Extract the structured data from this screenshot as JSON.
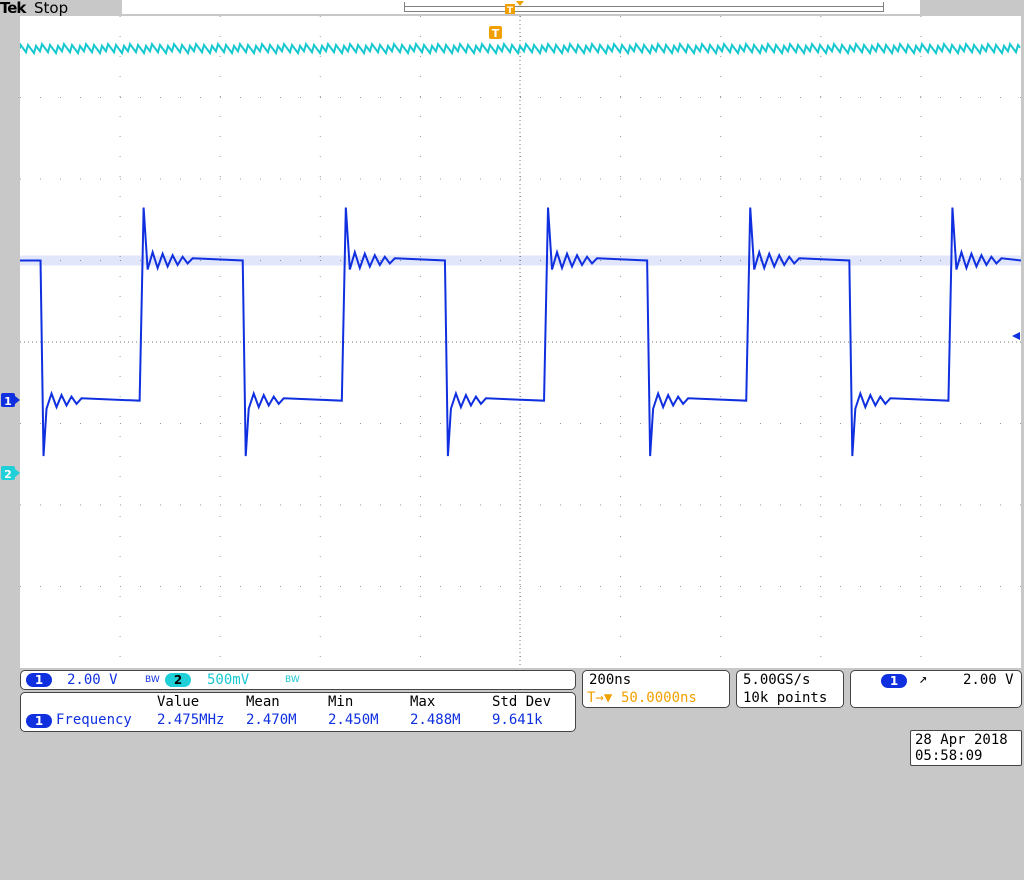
{
  "header": {
    "brand": "Tek",
    "status": "Stop"
  },
  "markers": {
    "trigger": "T",
    "ch1": "1",
    "ch2": "2"
  },
  "channels": {
    "ch1": {
      "num": "1",
      "scale": "2.00 V",
      "bw": "BW",
      "color": "#1030e0"
    },
    "ch2": {
      "num": "2",
      "scale": "500mV",
      "bw": "BW",
      "color": "#18c8d0"
    }
  },
  "timebase": {
    "scale": "200ns",
    "delay": "50.0000ns",
    "delay_prefix": "T→▼"
  },
  "acquisition": {
    "rate": "5.00GS/s",
    "points": "10k points"
  },
  "trigger": {
    "source": "1",
    "slope": "↗",
    "level": "2.00 V"
  },
  "measurement": {
    "headers": [
      "Value",
      "Mean",
      "Min",
      "Max",
      "Std Dev"
    ],
    "channel": "1",
    "name": "Frequency",
    "values": [
      "2.475MHz",
      "2.470M",
      "2.450M",
      "2.488M",
      "9.641k"
    ]
  },
  "datetime": {
    "date": "28 Apr  2018",
    "time": "05:58:09"
  },
  "chart_data": {
    "type": "line",
    "grid": true,
    "xlim": [
      -1000,
      1000
    ],
    "ylim": [
      -4,
      4
    ],
    "series": [
      {
        "channel": "1",
        "color": "#1030e0",
        "period_ns": 404,
        "high_div": 1.0,
        "low_div": -0.72,
        "overshoot_div": 1.65,
        "undershoot_div": -1.4,
        "first_fall_ns": -958,
        "low_duration_ns": 204
      },
      {
        "channel": "2",
        "color": "#18c8d0",
        "level_div": 3.6
      }
    ]
  }
}
